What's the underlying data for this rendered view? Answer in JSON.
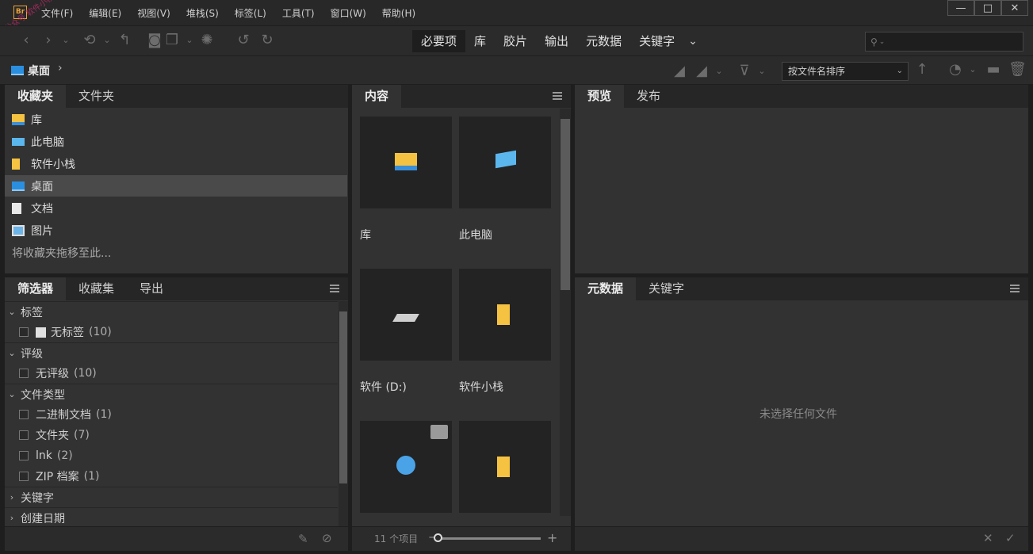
{
  "app": {
    "logo": "Br"
  },
  "watermark": "公众号 软件小栈",
  "menu": [
    "文件(F)",
    "编辑(E)",
    "视图(V)",
    "堆栈(S)",
    "标签(L)",
    "工具(T)",
    "窗口(W)",
    "帮助(H)"
  ],
  "window_controls": {
    "minimize": "—",
    "maximize": "□",
    "close": "✕"
  },
  "workspaces": {
    "items": [
      "必要项",
      "库",
      "胶片",
      "输出",
      "元数据",
      "关键字"
    ],
    "active": "必要项",
    "more": "⌄"
  },
  "search": {
    "placeholder": ""
  },
  "path": {
    "current": "桌面"
  },
  "sort": {
    "value": "按文件名排序"
  },
  "favorites_panel": {
    "tabs": [
      "收藏夹",
      "文件夹"
    ],
    "items": [
      {
        "label": "库",
        "icon": "library-icon"
      },
      {
        "label": "此电脑",
        "icon": "computer-icon"
      },
      {
        "label": "软件小栈",
        "icon": "folder-icon"
      },
      {
        "label": "桌面",
        "icon": "desktop-icon",
        "selected": true
      },
      {
        "label": "文档",
        "icon": "document-icon"
      },
      {
        "label": "图片",
        "icon": "pictures-icon"
      }
    ],
    "hint": "将收藏夹拖移至此..."
  },
  "filter_panel": {
    "tabs": [
      "筛选器",
      "收藏集",
      "导出"
    ],
    "groups": [
      {
        "label": "标签",
        "expanded": true,
        "items": [
          {
            "label": "无标签",
            "count": "(10)"
          }
        ]
      },
      {
        "label": "评级",
        "expanded": true,
        "items": [
          {
            "label": "无评级",
            "count": "(10)"
          }
        ]
      },
      {
        "label": "文件类型",
        "expanded": true,
        "items": [
          {
            "label": "二进制文档",
            "count": "(1)"
          },
          {
            "label": "文件夹",
            "count": "(7)"
          },
          {
            "label": "lnk",
            "count": "(2)"
          },
          {
            "label": "ZIP 档案",
            "count": "(1)"
          }
        ]
      },
      {
        "label": "关键字",
        "expanded": false,
        "items": []
      },
      {
        "label": "创建日期",
        "expanded": false,
        "items": []
      }
    ]
  },
  "content_panel": {
    "tabs": [
      "内容"
    ],
    "tiles": [
      {
        "label": "库",
        "icon": "library-icon"
      },
      {
        "label": "此电脑",
        "icon": "computer-icon"
      },
      {
        "label": "软件 (D:)",
        "icon": "drive-icon"
      },
      {
        "label": "软件小栈",
        "icon": "folder-icon"
      },
      {
        "label": "",
        "icon": "network-icon",
        "locked": true
      },
      {
        "label": "",
        "icon": "folder-icon"
      }
    ],
    "footer": {
      "count": "11 个项目"
    }
  },
  "preview_panel": {
    "tabs": [
      "预览",
      "发布"
    ]
  },
  "metadata_panel": {
    "tabs": [
      "元数据",
      "关键字"
    ],
    "empty": "未选择任何文件"
  },
  "colors": {
    "accent": "#e8a33a",
    "folder": "#f5c242",
    "desktop": "#2b8fe0"
  }
}
